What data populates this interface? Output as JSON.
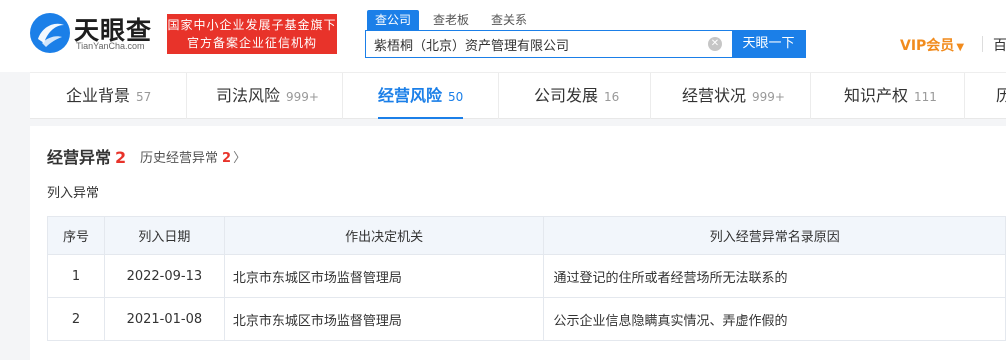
{
  "header": {
    "logo_text": "天眼查",
    "logo_sub": "TianYanCha.com",
    "badge_line1": "国家中小企业发展子基金旗下",
    "badge_line2": "官方备案企业征信机构",
    "search_tabs": [
      "查公司",
      "查老板",
      "查关系"
    ],
    "search_value": "紫梧桐（北京）资产管理有限公司",
    "search_button": "天眼一下",
    "vip_label": "VIP会员",
    "more_label": "百"
  },
  "nav": [
    {
      "label": "企业背景",
      "count": "57"
    },
    {
      "label": "司法风险",
      "count": "999+"
    },
    {
      "label": "经营风险",
      "count": "50"
    },
    {
      "label": "公司发展",
      "count": "16"
    },
    {
      "label": "经营状况",
      "count": "999+"
    },
    {
      "label": "知识产权",
      "count": "111"
    },
    {
      "label": "历",
      "count": ""
    }
  ],
  "section": {
    "title": "经营异常",
    "count": "2",
    "history_label": "历史经营异常",
    "history_count": "2",
    "sub_title": "列入异常"
  },
  "table": {
    "headers": [
      "序号",
      "列入日期",
      "作出决定机关",
      "列入经营异常名录原因"
    ],
    "rows": [
      {
        "no": "1",
        "date": "2022-09-13",
        "authority": "北京市东城区市场监督管理局",
        "reason": "通过登记的住所或者经营场所无法联系的"
      },
      {
        "no": "2",
        "date": "2021-01-08",
        "authority": "北京市东城区市场监督管理局",
        "reason": "公示企业信息隐瞒真实情况、弄虚作假的"
      }
    ]
  },
  "colors": {
    "brand": "#1b7fe8",
    "alert": "#e8332a",
    "vip": "#f18b1d"
  }
}
